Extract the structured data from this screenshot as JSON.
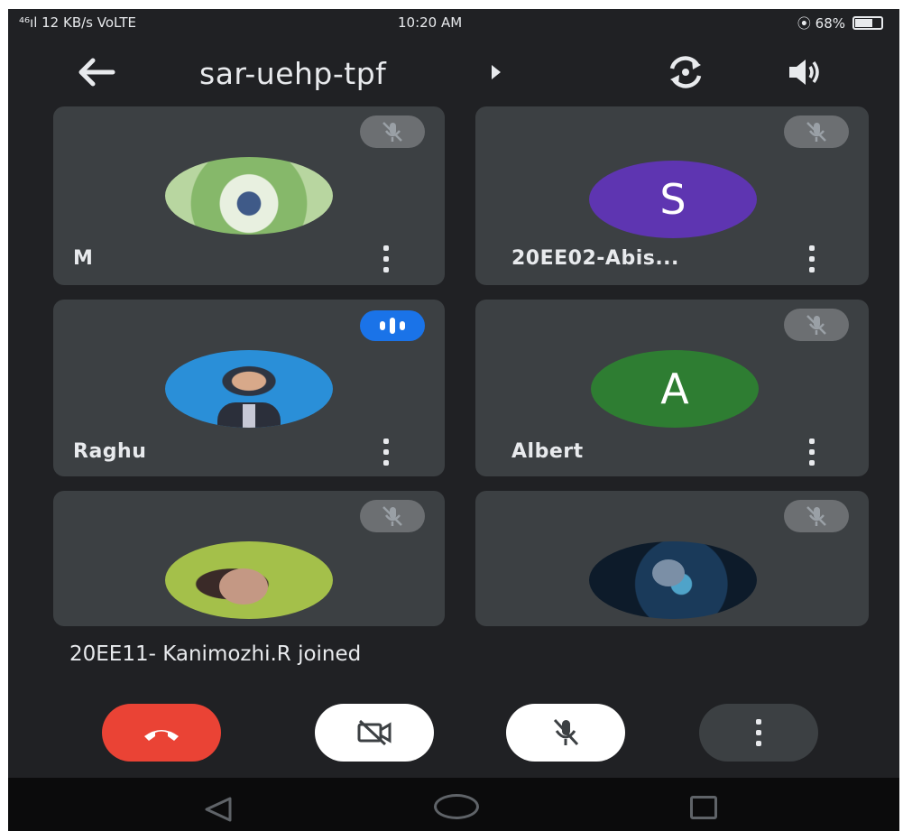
{
  "status_bar": {
    "left": "⁴⁶ıl 12 KB/s  VoLTE",
    "time": "10:20 AM",
    "right": "⦿ 68%"
  },
  "header": {
    "meeting_code": "sar-uehp-tpf"
  },
  "participants": [
    {
      "name": "M",
      "avatar_type": "photo",
      "mic_state": "muted"
    },
    {
      "name": "20EE02-Abis...",
      "avatar_type": "letter",
      "avatar_letter": "S",
      "avatar_color": "#5e35b1",
      "mic_state": "muted"
    },
    {
      "name": "Raghu",
      "avatar_type": "photo",
      "mic_state": "speaking"
    },
    {
      "name": "Albert",
      "avatar_type": "letter",
      "avatar_letter": "A",
      "avatar_color": "#2e7d32",
      "mic_state": "muted"
    },
    {
      "name": "",
      "avatar_type": "photo",
      "mic_state": "muted"
    },
    {
      "name": "",
      "avatar_type": "photo",
      "mic_state": "muted"
    }
  ],
  "notification": "20EE11- Kanimozhi.R joined",
  "controls": {
    "end_call_icon": "phone-hangup-icon",
    "camera_icon": "camera-off-icon",
    "mic_icon": "mic-off-icon",
    "more_icon": "more-vertical-icon"
  },
  "colors": {
    "background": "#202124",
    "tile": "#3c4043",
    "end_call": "#ea4335",
    "speaking": "#1a73e8"
  }
}
